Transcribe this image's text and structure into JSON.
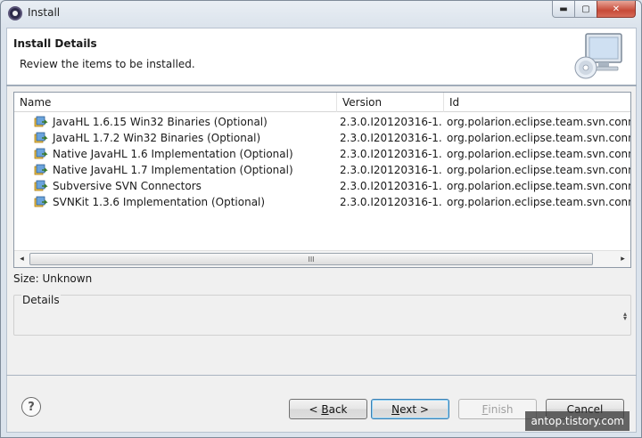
{
  "window": {
    "title": "Install",
    "controls": {
      "minimize": "▬",
      "maximize": "▢",
      "close": "✕"
    }
  },
  "header": {
    "title": "Install Details",
    "description": "Review the items to be installed."
  },
  "table": {
    "columns": {
      "name": "Name",
      "version": "Version",
      "id": "Id"
    },
    "rows": [
      {
        "name": "JavaHL 1.6.15 Win32 Binaries (Optional)",
        "version": "2.3.0.I20120316-1...",
        "id": "org.polarion.eclipse.team.svn.connector"
      },
      {
        "name": "JavaHL 1.7.2 Win32 Binaries (Optional)",
        "version": "2.3.0.I20120316-1...",
        "id": "org.polarion.eclipse.team.svn.connector"
      },
      {
        "name": "Native JavaHL 1.6 Implementation (Optional)",
        "version": "2.3.0.I20120316-1...",
        "id": "org.polarion.eclipse.team.svn.connector"
      },
      {
        "name": "Native JavaHL 1.7 Implementation (Optional)",
        "version": "2.3.0.I20120316-1...",
        "id": "org.polarion.eclipse.team.svn.connector"
      },
      {
        "name": "Subversive SVN Connectors",
        "version": "2.3.0.I20120316-1...",
        "id": "org.polarion.eclipse.team.svn.connector"
      },
      {
        "name": "SVNKit 1.3.6 Implementation (Optional)",
        "version": "2.3.0.I20120316-1...",
        "id": "org.polarion.eclipse.team.svn.connector"
      }
    ],
    "scroll_thumb_grip": "III",
    "scroll_left": "◂",
    "scroll_right": "▸"
  },
  "size_label": "Size: Unknown",
  "details": {
    "label": "Details",
    "spin_up": "▴",
    "spin_down": "▾"
  },
  "footer": {
    "help": "?",
    "back_pre": "< ",
    "back_key": "B",
    "back_rest": "ack",
    "next_key": "N",
    "next_rest": "ext >",
    "finish_key": "F",
    "finish_rest": "inish",
    "cancel": "Cancel"
  },
  "watermark": "antop.tistory.com",
  "colors": {
    "accent": "#3c7fb1",
    "close": "#c74a38",
    "feature_icon": "#4a86c8"
  },
  "icons": {
    "app": "eclipse-icon",
    "header": "monitor-cd-icon",
    "row": "feature-plugin-icon"
  }
}
